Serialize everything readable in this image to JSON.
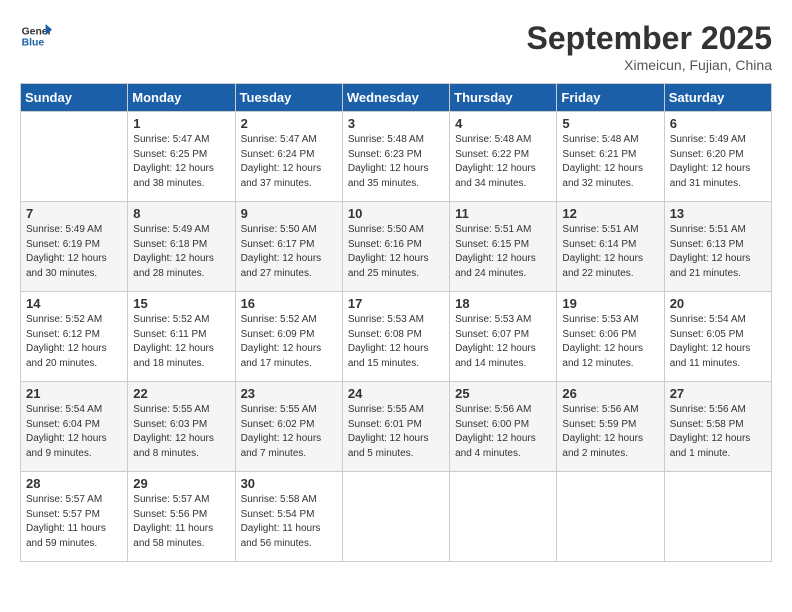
{
  "header": {
    "logo_general": "General",
    "logo_blue": "Blue",
    "month_title": "September 2025",
    "location": "Ximeicun, Fujian, China"
  },
  "days_of_week": [
    "Sunday",
    "Monday",
    "Tuesday",
    "Wednesday",
    "Thursday",
    "Friday",
    "Saturday"
  ],
  "weeks": [
    [
      {
        "day": "",
        "info": ""
      },
      {
        "day": "1",
        "info": "Sunrise: 5:47 AM\nSunset: 6:25 PM\nDaylight: 12 hours\nand 38 minutes."
      },
      {
        "day": "2",
        "info": "Sunrise: 5:47 AM\nSunset: 6:24 PM\nDaylight: 12 hours\nand 37 minutes."
      },
      {
        "day": "3",
        "info": "Sunrise: 5:48 AM\nSunset: 6:23 PM\nDaylight: 12 hours\nand 35 minutes."
      },
      {
        "day": "4",
        "info": "Sunrise: 5:48 AM\nSunset: 6:22 PM\nDaylight: 12 hours\nand 34 minutes."
      },
      {
        "day": "5",
        "info": "Sunrise: 5:48 AM\nSunset: 6:21 PM\nDaylight: 12 hours\nand 32 minutes."
      },
      {
        "day": "6",
        "info": "Sunrise: 5:49 AM\nSunset: 6:20 PM\nDaylight: 12 hours\nand 31 minutes."
      }
    ],
    [
      {
        "day": "7",
        "info": "Sunrise: 5:49 AM\nSunset: 6:19 PM\nDaylight: 12 hours\nand 30 minutes."
      },
      {
        "day": "8",
        "info": "Sunrise: 5:49 AM\nSunset: 6:18 PM\nDaylight: 12 hours\nand 28 minutes."
      },
      {
        "day": "9",
        "info": "Sunrise: 5:50 AM\nSunset: 6:17 PM\nDaylight: 12 hours\nand 27 minutes."
      },
      {
        "day": "10",
        "info": "Sunrise: 5:50 AM\nSunset: 6:16 PM\nDaylight: 12 hours\nand 25 minutes."
      },
      {
        "day": "11",
        "info": "Sunrise: 5:51 AM\nSunset: 6:15 PM\nDaylight: 12 hours\nand 24 minutes."
      },
      {
        "day": "12",
        "info": "Sunrise: 5:51 AM\nSunset: 6:14 PM\nDaylight: 12 hours\nand 22 minutes."
      },
      {
        "day": "13",
        "info": "Sunrise: 5:51 AM\nSunset: 6:13 PM\nDaylight: 12 hours\nand 21 minutes."
      }
    ],
    [
      {
        "day": "14",
        "info": "Sunrise: 5:52 AM\nSunset: 6:12 PM\nDaylight: 12 hours\nand 20 minutes."
      },
      {
        "day": "15",
        "info": "Sunrise: 5:52 AM\nSunset: 6:11 PM\nDaylight: 12 hours\nand 18 minutes."
      },
      {
        "day": "16",
        "info": "Sunrise: 5:52 AM\nSunset: 6:09 PM\nDaylight: 12 hours\nand 17 minutes."
      },
      {
        "day": "17",
        "info": "Sunrise: 5:53 AM\nSunset: 6:08 PM\nDaylight: 12 hours\nand 15 minutes."
      },
      {
        "day": "18",
        "info": "Sunrise: 5:53 AM\nSunset: 6:07 PM\nDaylight: 12 hours\nand 14 minutes."
      },
      {
        "day": "19",
        "info": "Sunrise: 5:53 AM\nSunset: 6:06 PM\nDaylight: 12 hours\nand 12 minutes."
      },
      {
        "day": "20",
        "info": "Sunrise: 5:54 AM\nSunset: 6:05 PM\nDaylight: 12 hours\nand 11 minutes."
      }
    ],
    [
      {
        "day": "21",
        "info": "Sunrise: 5:54 AM\nSunset: 6:04 PM\nDaylight: 12 hours\nand 9 minutes."
      },
      {
        "day": "22",
        "info": "Sunrise: 5:55 AM\nSunset: 6:03 PM\nDaylight: 12 hours\nand 8 minutes."
      },
      {
        "day": "23",
        "info": "Sunrise: 5:55 AM\nSunset: 6:02 PM\nDaylight: 12 hours\nand 7 minutes."
      },
      {
        "day": "24",
        "info": "Sunrise: 5:55 AM\nSunset: 6:01 PM\nDaylight: 12 hours\nand 5 minutes."
      },
      {
        "day": "25",
        "info": "Sunrise: 5:56 AM\nSunset: 6:00 PM\nDaylight: 12 hours\nand 4 minutes."
      },
      {
        "day": "26",
        "info": "Sunrise: 5:56 AM\nSunset: 5:59 PM\nDaylight: 12 hours\nand 2 minutes."
      },
      {
        "day": "27",
        "info": "Sunrise: 5:56 AM\nSunset: 5:58 PM\nDaylight: 12 hours\nand 1 minute."
      }
    ],
    [
      {
        "day": "28",
        "info": "Sunrise: 5:57 AM\nSunset: 5:57 PM\nDaylight: 11 hours\nand 59 minutes."
      },
      {
        "day": "29",
        "info": "Sunrise: 5:57 AM\nSunset: 5:56 PM\nDaylight: 11 hours\nand 58 minutes."
      },
      {
        "day": "30",
        "info": "Sunrise: 5:58 AM\nSunset: 5:54 PM\nDaylight: 11 hours\nand 56 minutes."
      },
      {
        "day": "",
        "info": ""
      },
      {
        "day": "",
        "info": ""
      },
      {
        "day": "",
        "info": ""
      },
      {
        "day": "",
        "info": ""
      }
    ]
  ]
}
